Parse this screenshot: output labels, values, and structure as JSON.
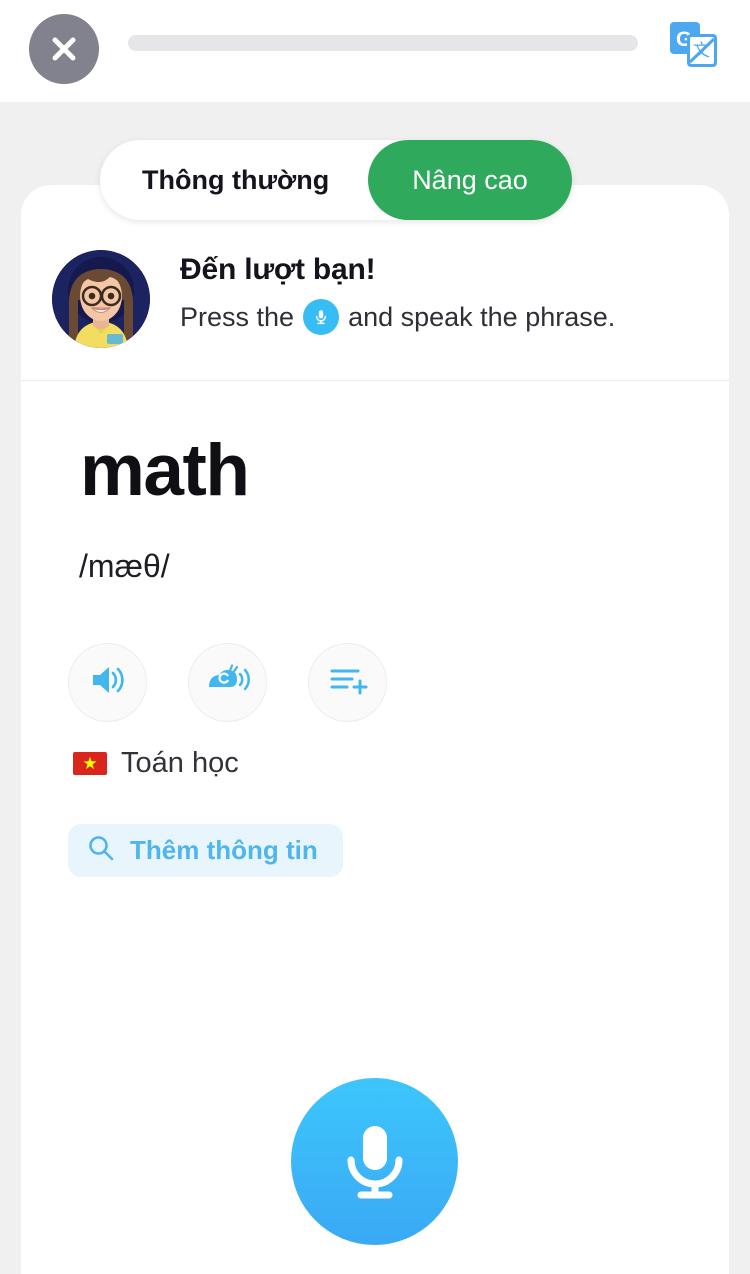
{
  "topbar": {
    "close_label": "close",
    "close_icon": "close-x-icon",
    "progress_percent": 0,
    "translate_icon": "google-translate-icon"
  },
  "tabs": [
    {
      "label": "Thông thường",
      "active": false
    },
    {
      "label": "Nâng cao",
      "active": true
    }
  ],
  "prompt": {
    "avatar_icon": "teacher-avatar",
    "title": "Đến lượt bạn!",
    "sub_before": "Press the",
    "sub_icon": "microphone-icon",
    "sub_after": "and speak the phrase."
  },
  "entry": {
    "word": "math",
    "phonetic": "/mæθ/",
    "actions": [
      {
        "name": "speaker-icon",
        "label": "Play audio"
      },
      {
        "name": "snail-speaker-icon",
        "label": "Play slow audio"
      },
      {
        "name": "add-to-list-icon",
        "label": "Add to list"
      }
    ],
    "translation": {
      "flag": "🇻🇳",
      "flag_name": "vietnam-flag-icon",
      "text": "Toán học"
    },
    "more_info": {
      "icon": "search-icon",
      "label": "Thêm thông tin"
    }
  },
  "record": {
    "icon": "microphone-icon",
    "label": "Record"
  },
  "colors": {
    "accent_green": "#2fa95c",
    "accent_blue": "#36bdf4",
    "mic_blue": "#3dc6fb",
    "close_gray": "#82828f",
    "page_bg": "#f0f0f0",
    "more_info_bg": "#e9f5fd"
  }
}
